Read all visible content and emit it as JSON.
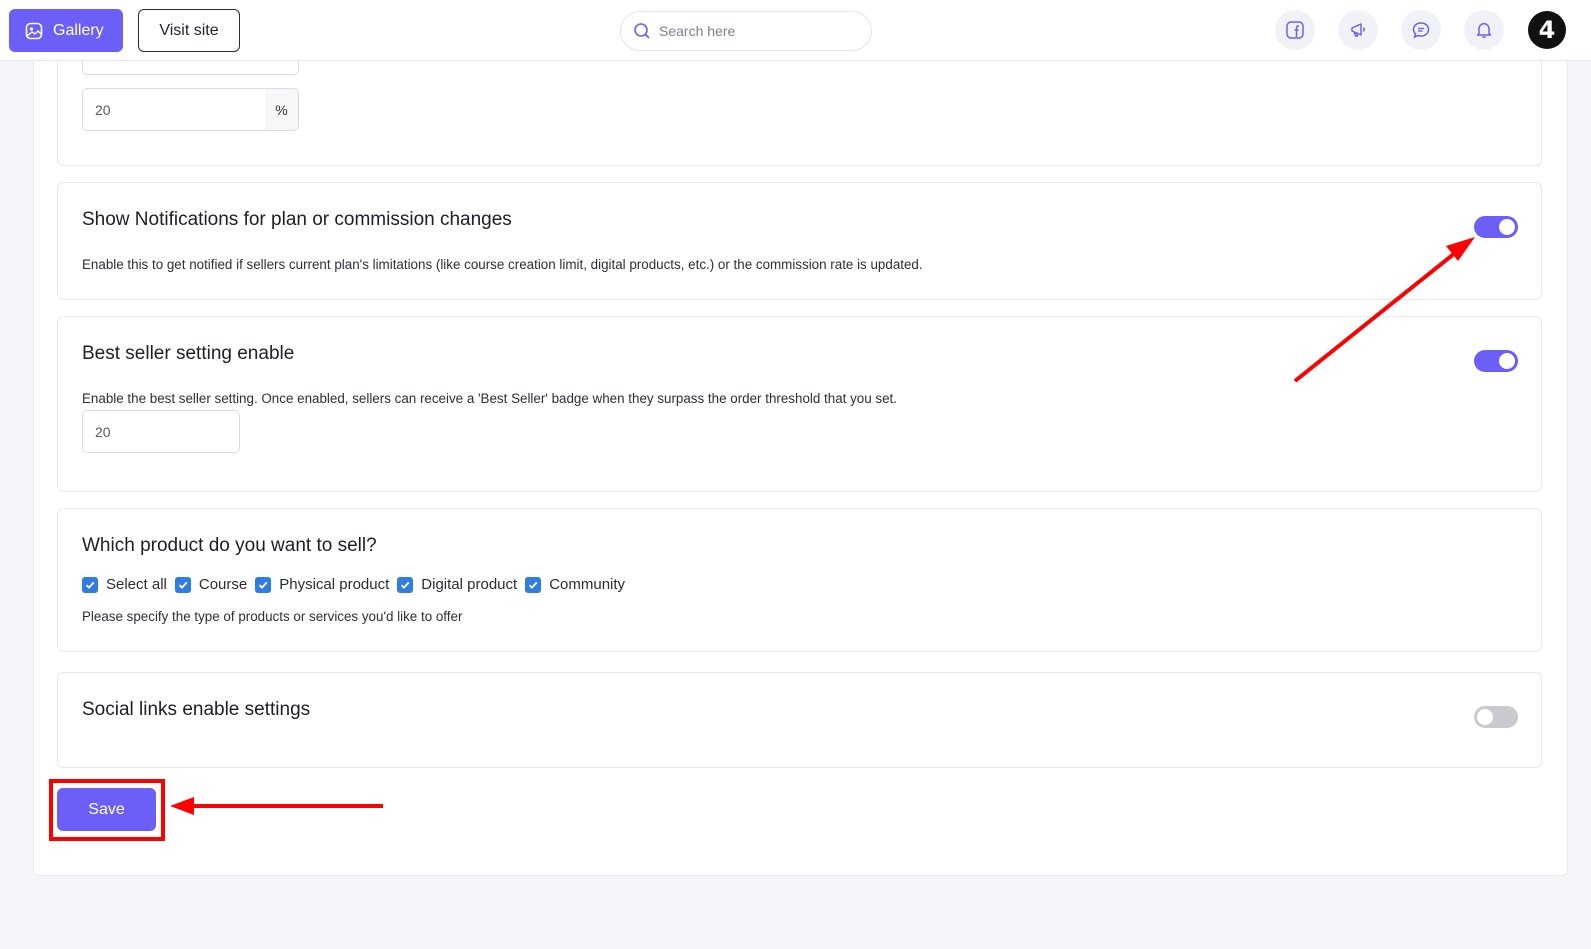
{
  "header": {
    "gallery_label": "Gallery",
    "visit_site_label": "Visit site",
    "search_placeholder": "Search here",
    "avatar_text": "4"
  },
  "commission_card": {
    "value": "20",
    "unit": "%"
  },
  "notifications_card": {
    "title": "Show Notifications for plan or commission changes",
    "description": "Enable this to get notified if sellers current plan's limitations (like course creation limit, digital products, etc.) or the commission rate is updated.",
    "enabled": true
  },
  "best_seller_card": {
    "title": "Best seller setting enable",
    "description": "Enable the best seller setting. Once enabled, sellers can receive a 'Best Seller' badge when they surpass the order threshold that you set.",
    "threshold": "20",
    "enabled": true
  },
  "products_card": {
    "title": "Which product do you want to sell?",
    "options": [
      {
        "label": "Select all",
        "checked": true
      },
      {
        "label": "Course",
        "checked": true
      },
      {
        "label": "Physical product",
        "checked": true
      },
      {
        "label": "Digital product",
        "checked": true
      },
      {
        "label": "Community",
        "checked": true
      }
    ],
    "hint": "Please specify the type of products or services you'd like to offer"
  },
  "social_card": {
    "title": "Social links enable settings",
    "enabled": false
  },
  "save_label": "Save",
  "colors": {
    "accent": "#6c5ff7",
    "annotation": "#ff0000",
    "checkbox": "#2f7de1"
  }
}
